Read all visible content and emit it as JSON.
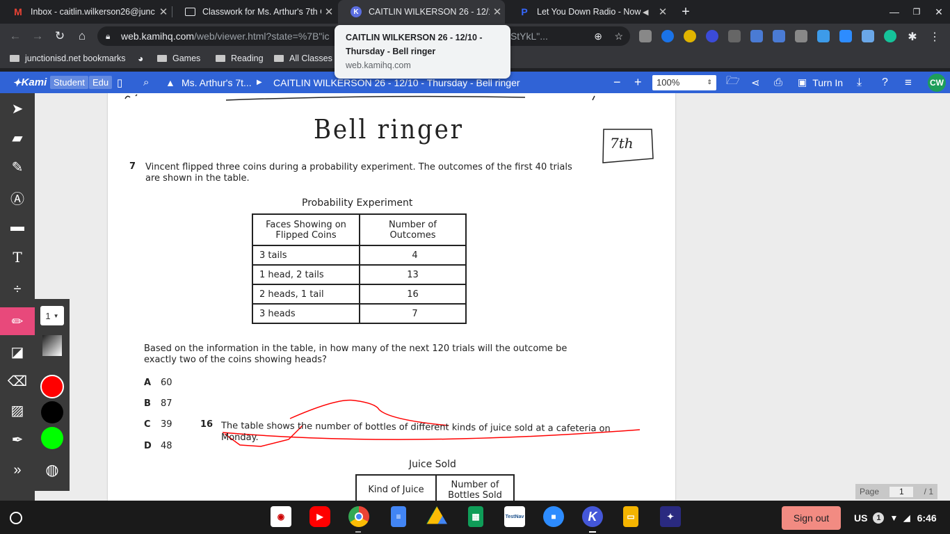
{
  "browser": {
    "tabs": [
      {
        "title": "Inbox - caitlin.wilkerson26@junc",
        "icon": "gmail-icon"
      },
      {
        "title": "Classwork for Ms. Arthur's 7th G",
        "icon": "classroom-icon"
      },
      {
        "title": "CAITLIN WILKERSON 26 - 12/10",
        "icon": "kami-icon"
      },
      {
        "title": "Let You Down Radio - Now P",
        "icon": "pandora-icon"
      }
    ],
    "url_host": "web.kamihq.com",
    "url_path": "/web/viewer.html?state=%7B\"ic",
    "url_tail": "RfmfOStYkL\"...",
    "tooltip": {
      "title": "CAITLIN WILKERSON 26 - 12/10 - Thursday - Bell ringer",
      "host": "web.kamihq.com"
    },
    "bookmarks": [
      {
        "label": "junctionisd.net bookmarks"
      },
      {
        "label": ""
      },
      {
        "label": "Games"
      },
      {
        "label": "Reading"
      },
      {
        "label": "All Classes"
      }
    ]
  },
  "kami": {
    "logo": "Kami",
    "badge_student": "Student",
    "badge_edu": "Edu",
    "breadcrumb_class": "Ms. Arthur's 7t...",
    "doc_title": "CAITLIN WILKERSON 26 - 12/10 - Thursday - Bell ringer",
    "zoom": "100%",
    "turn_in": "Turn In",
    "avatar": "CW",
    "stroke_size": "1",
    "colors": {
      "red": "#ff0000",
      "black": "#000000",
      "green": "#00ff00",
      "accent": "#3063d6",
      "tool_selected": "#e8497b"
    }
  },
  "document": {
    "handwritten_title": "Bell ringer",
    "handwritten_grade": "7th",
    "q7_num": "7",
    "q7_text_1": "Vincent flipped three coins during a probability experiment. The outcomes of the first 40 trials",
    "q7_text_2": "are shown in the table.",
    "table_title": "Probability Experiment",
    "table_head_1a": "Faces Showing on",
    "table_head_1b": "Flipped Coins",
    "table_head_2a": "Number of",
    "table_head_2b": "Outcomes",
    "rows": [
      {
        "face": "3 tails",
        "count": "4"
      },
      {
        "face": "1 head, 2 tails",
        "count": "13"
      },
      {
        "face": "2 heads, 1 tail",
        "count": "16"
      },
      {
        "face": "3 heads",
        "count": "7"
      }
    ],
    "q7_ask_1": "Based on the information in the table, in how many of the next 120 trials will the outcome be",
    "q7_ask_2": "exactly two of the coins showing heads?",
    "choices": [
      {
        "letter": "A",
        "value": "60"
      },
      {
        "letter": "B",
        "value": "87"
      },
      {
        "letter": "C",
        "value": "39"
      },
      {
        "letter": "D",
        "value": "48"
      }
    ],
    "q16_num": "16",
    "q16_text_1": "The table shows the number of bottles of different kinds of juice sold at a cafeteria on",
    "q16_text_2": "Monday.",
    "juice_title": "Juice Sold",
    "juice_head_1": "Kind of Juice",
    "juice_head_2a": "Number of",
    "juice_head_2b": "Bottles Sold"
  },
  "pager": {
    "label": "Page",
    "current": "1",
    "total": "/ 1"
  },
  "taskbar": {
    "sign_out": "Sign out",
    "locale": "US",
    "notif_count": "1",
    "time": "6:46"
  }
}
